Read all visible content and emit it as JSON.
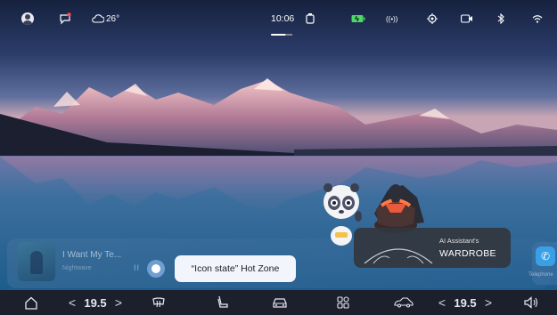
{
  "status_bar": {
    "temperature": "26°",
    "time": "10:06"
  },
  "media": {
    "song_title": "I Want My Te...",
    "artist": "Nightwave",
    "pause_glyph": "II"
  },
  "hotzone_tip": "“Icon state” Hot Zone",
  "ai_card": {
    "label": "AI Assistant's",
    "title": "WARDROBE"
  },
  "phone": {
    "label": "Telephone"
  },
  "dock": {
    "left_temp": "19.5",
    "right_temp": "19.5",
    "arrow_left": "<",
    "arrow_right": ">"
  },
  "icons": [
    "user-avatar-icon",
    "message-icon",
    "cloud-icon",
    "power-bank-icon",
    "battery-icon",
    "radio-icon",
    "location-icon",
    "camera-icon",
    "bluetooth-icon",
    "wifi-icon",
    "home-icon",
    "rear-defrost-icon",
    "seat-icon",
    "car-icon",
    "apps-icon",
    "car-side-icon",
    "volume-icon",
    "phone-icon"
  ],
  "colors": {
    "dock": "#1c1f2c",
    "accent_green": "#4cd964",
    "message_badge": "#ff4d4d",
    "tooltip_bg": "#f2f5fb"
  }
}
